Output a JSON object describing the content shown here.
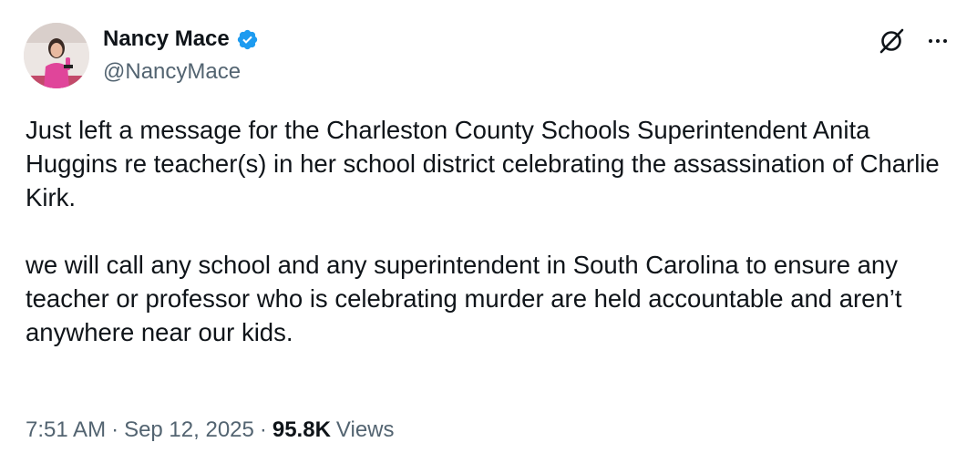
{
  "author": {
    "display_name": "Nancy Mace",
    "handle": "@NancyMace",
    "verified": true,
    "verified_color": "#1d9bf0"
  },
  "header_icons": {
    "grok": "grok-icon",
    "more": "more-options-icon"
  },
  "tweet": {
    "text": "Just left a message for the Charleston County Schools Superintendent Anita Huggins re teacher(s) in her school district celebrating the assassination of Charlie Kirk.\n\nwe will call any school and any superintendent in South Carolina to ensure any teacher or professor who is celebrating murder are held accountable and aren’t anywhere near our kids."
  },
  "meta": {
    "time": "7:51 AM",
    "date": "Sep 12, 2025",
    "separator": "·",
    "views_count": "95.8K",
    "views_label": "Views"
  },
  "colors": {
    "text_primary": "#0f1419",
    "text_secondary": "#536471",
    "background": "#ffffff"
  }
}
